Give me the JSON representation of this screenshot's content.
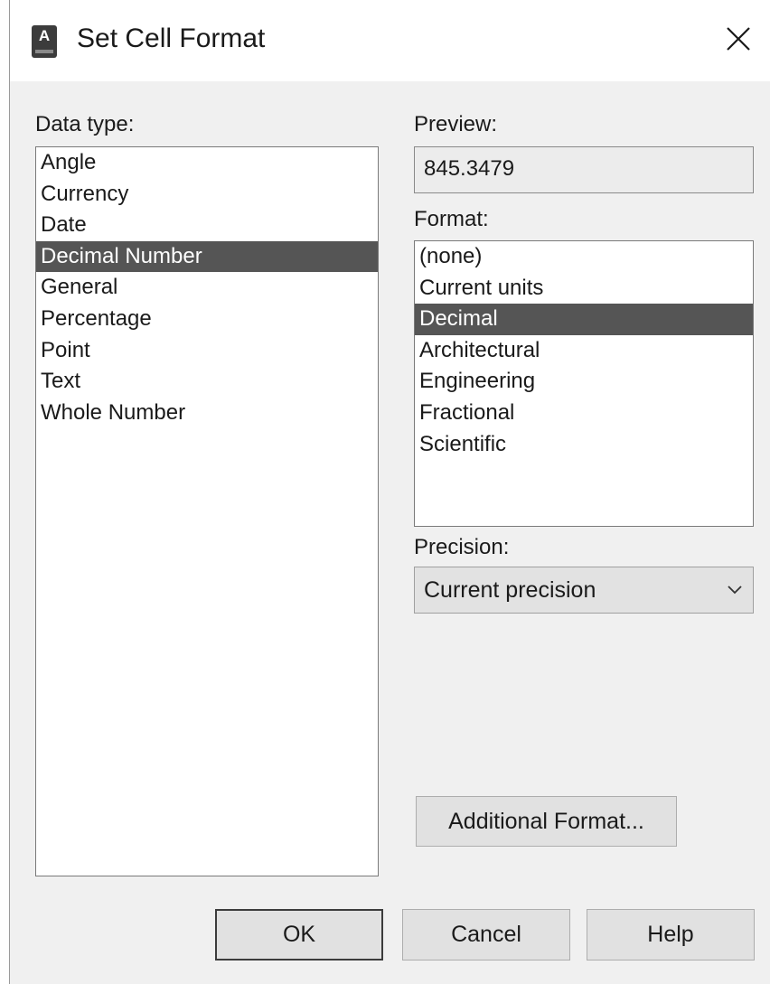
{
  "title": "Set Cell Format",
  "icon": "autocad-app-icon",
  "app_icon_letter": "A",
  "data_type": {
    "label": "Data type:",
    "items": [
      "Angle",
      "Currency",
      "Date",
      "Decimal Number",
      "General",
      "Percentage",
      "Point",
      "Text",
      "Whole Number"
    ],
    "selected": "Decimal Number"
  },
  "preview": {
    "label": "Preview:",
    "value": "845.3479"
  },
  "format": {
    "label": "Format:",
    "items": [
      "(none)",
      "Current units",
      "Decimal",
      "Architectural",
      "Engineering",
      "Fractional",
      "Scientific"
    ],
    "selected": "Decimal"
  },
  "precision": {
    "label": "Precision:",
    "value": "Current precision"
  },
  "buttons": {
    "additional": "Additional Format...",
    "ok": "OK",
    "cancel": "Cancel",
    "help": "Help"
  },
  "colors": {
    "selection": "#555555",
    "dialog_bg": "#f0f0f0"
  }
}
